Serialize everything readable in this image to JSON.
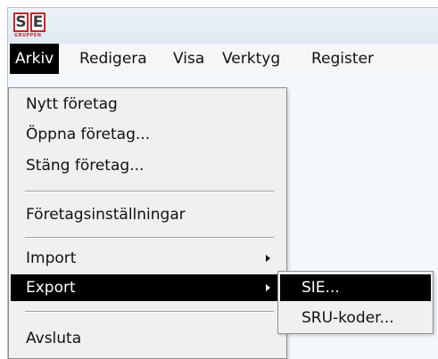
{
  "app": {
    "logo_text_s": "S",
    "logo_text_e": "E",
    "logo_sub": "GRUPPEN",
    "accent_color": "#c0282d",
    "highlight_color": "#000000"
  },
  "menubar": {
    "items": [
      {
        "label": "Arkiv"
      },
      {
        "label": "Redigera"
      },
      {
        "label": "Visa"
      },
      {
        "label": "Verktyg"
      },
      {
        "label": "Register"
      }
    ]
  },
  "arkiv_menu": {
    "items": [
      {
        "label": "Nytt företag"
      },
      {
        "label": "Öppna företag..."
      },
      {
        "label": "Stäng företag..."
      },
      {
        "label": "Företagsinställningar"
      },
      {
        "label": "Import"
      },
      {
        "label": "Export"
      },
      {
        "label": "Avsluta"
      }
    ]
  },
  "export_submenu": {
    "items": [
      {
        "label": "SIE..."
      },
      {
        "label": "SRU-koder..."
      }
    ]
  }
}
